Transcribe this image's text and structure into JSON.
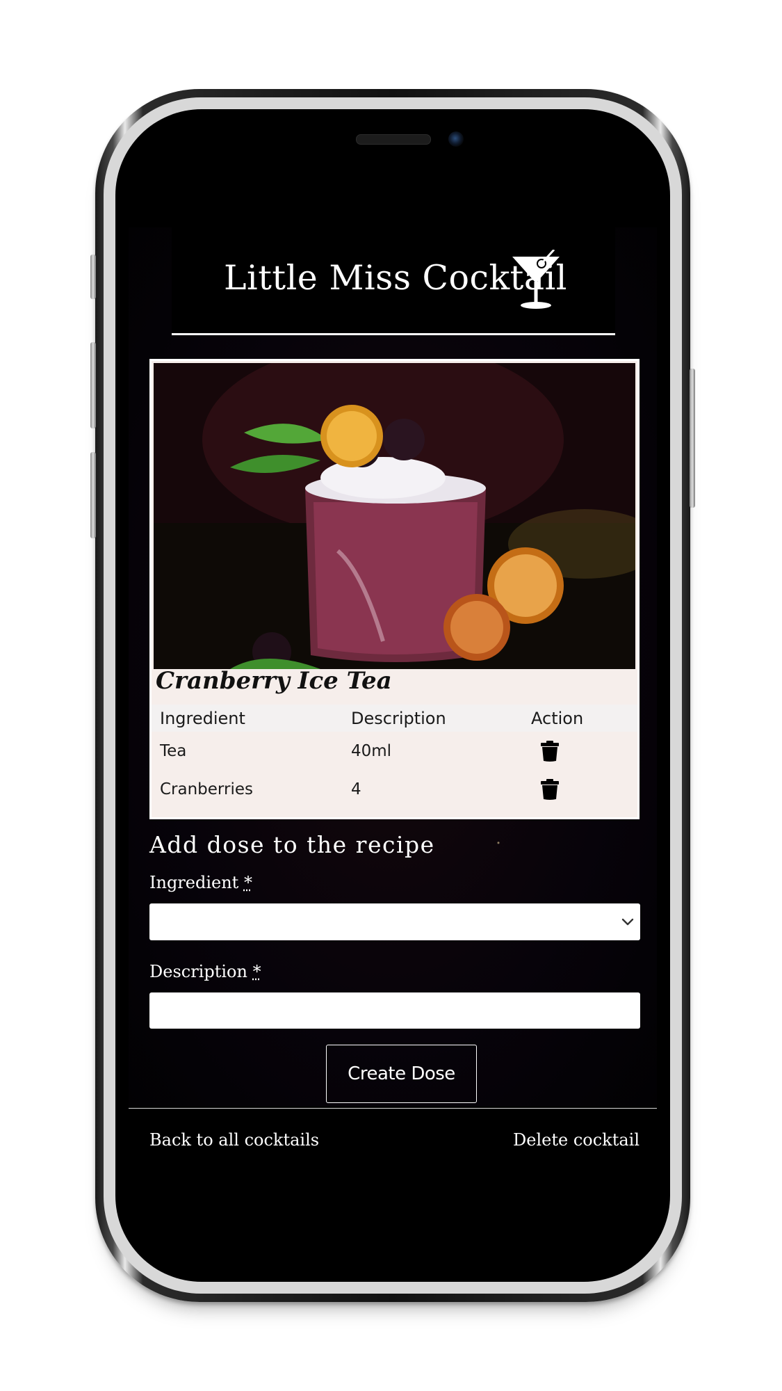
{
  "app": {
    "title": "Little Miss Cocktail"
  },
  "cocktail": {
    "name": "Cranberry Ice Tea"
  },
  "table": {
    "headers": [
      "Ingredient",
      "Description",
      "Action"
    ],
    "rows": [
      {
        "ingredient": "Tea",
        "description": "40ml"
      },
      {
        "ingredient": "Cranberries",
        "description": "4"
      }
    ]
  },
  "form": {
    "title": "Add dose to the recipe",
    "ingredient_label": "Ingredient",
    "description_label": "Description",
    "required_mark": "*",
    "ingredient_value": "",
    "description_value": "",
    "submit_label": "Create Dose"
  },
  "footer": {
    "back_label": "Back to all cocktails",
    "delete_label": "Delete cocktail"
  },
  "icons": {
    "logo": "martini-glass-icon",
    "delete": "trash-icon",
    "select": "chevron-down-icon"
  },
  "colors": {
    "background": "#000000",
    "card": "#f6eeeb",
    "text_light": "#ffffff",
    "text_dark": "#1a1a1a"
  }
}
